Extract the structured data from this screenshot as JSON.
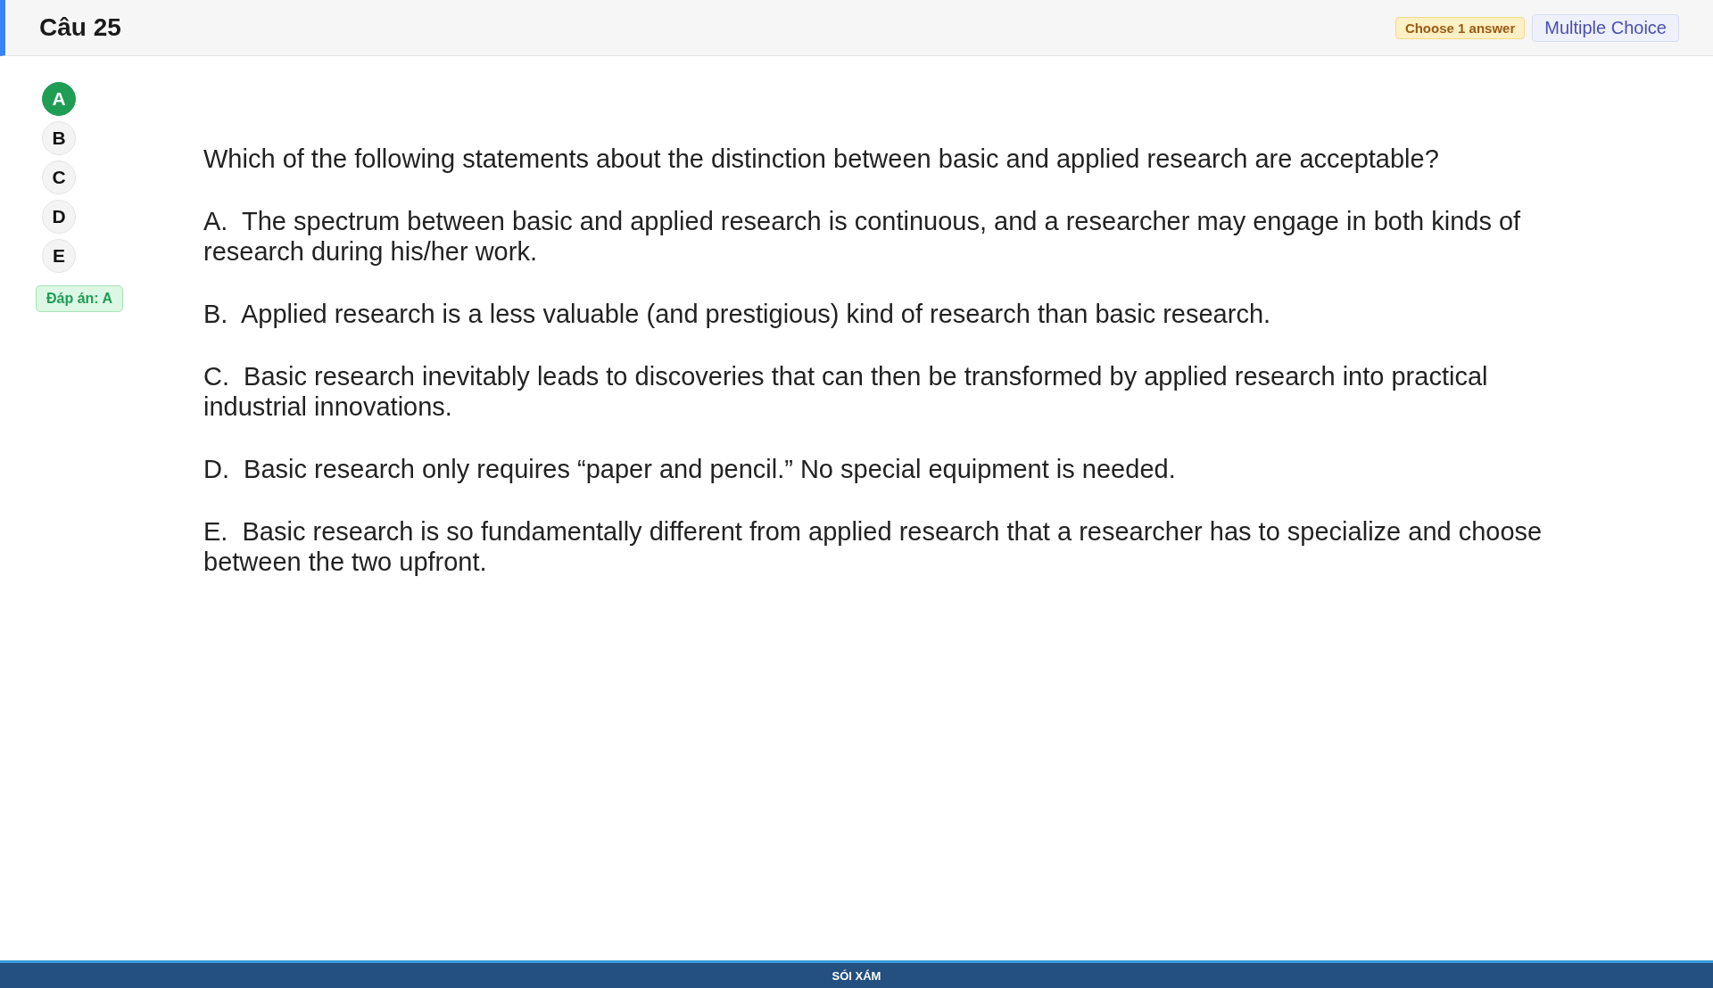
{
  "header": {
    "title": "Câu 25",
    "badges": [
      {
        "kind": "hint",
        "text": "Choose 1 answer"
      },
      {
        "kind": "type",
        "text": "Multiple Choice"
      }
    ]
  },
  "answer_choices": [
    {
      "letter": "A",
      "selected": true
    },
    {
      "letter": "B",
      "selected": false
    },
    {
      "letter": "C",
      "selected": false
    },
    {
      "letter": "D",
      "selected": false
    },
    {
      "letter": "E",
      "selected": false
    }
  ],
  "answer_key": "Đáp án: A",
  "question": {
    "text": "Which of the following statements about the distinction between basic and applied research are acceptable?",
    "options": [
      "A.  The spectrum between basic and applied research is continuous, and a researcher may engage in both kinds of research during his/her work.",
      "B.  Applied research is a less valuable (and prestigious) kind of research than basic research.",
      "C.  Basic research inevitably leads to discoveries that can then be transformed by applied research into practical industrial innovations.",
      "D.  Basic research only requires “paper and pencil.” No special equipment is needed.",
      "E.  Basic research is so fundamentally different from applied research that a researcher has to specialize and choose between the two upfront."
    ]
  },
  "footer": {
    "text": "SÓI XÁM"
  }
}
